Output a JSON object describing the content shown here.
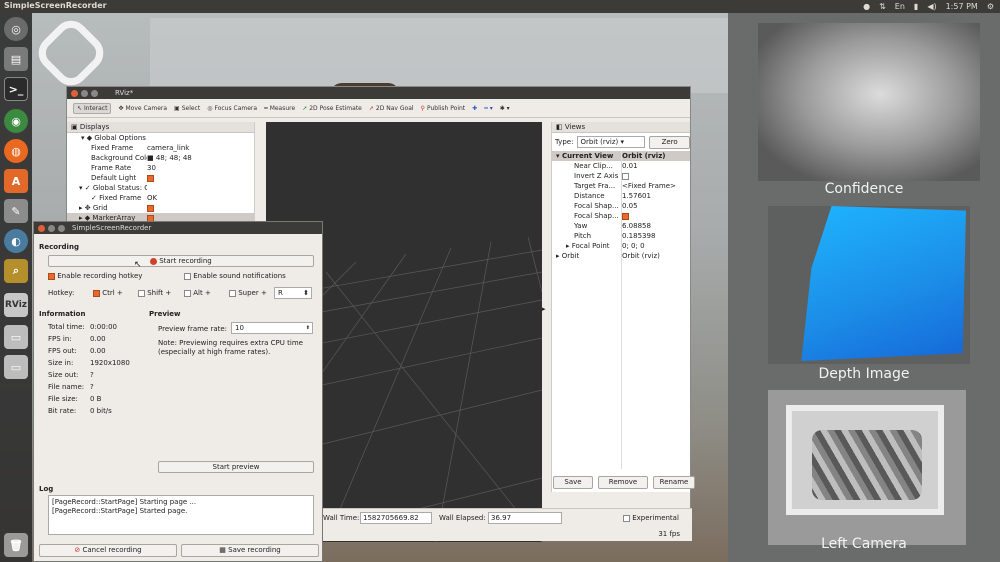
{
  "topbar": {
    "title": "SimpleScreenRecorder",
    "clock": "1:57 PM",
    "lang": "En"
  },
  "launcher": {
    "rviz_label": "RViz"
  },
  "camera_panels": {
    "confidence": "Confidence",
    "depth": "Depth Image",
    "left": "Left Camera"
  },
  "rviz": {
    "title": "RViz*",
    "toolbar": [
      "Interact",
      "Move Camera",
      "Select",
      "Focus Camera",
      "Measure",
      "2D Pose Estimate",
      "2D Nav Goal",
      "Publish Point"
    ],
    "displays_title": "Displays",
    "displays": [
      {
        "k": "Global Options",
        "v": ""
      },
      {
        "k": "Fixed Frame",
        "v": "camera_link"
      },
      {
        "k": "Background Color",
        "v": "48; 48; 48"
      },
      {
        "k": "Frame Rate",
        "v": "30"
      },
      {
        "k": "Default Light",
        "v": ""
      },
      {
        "k": "Global Status: Ok",
        "v": ""
      },
      {
        "k": "Fixed Frame",
        "v": "OK"
      },
      {
        "k": "Grid",
        "v": ""
      },
      {
        "k": "MarkerArray",
        "v": ""
      }
    ],
    "views_title": "Views",
    "type_label": "Type:",
    "type_value": "Orbit (rviz)",
    "zero": "Zero",
    "views": [
      {
        "k": "Current View",
        "v": "Orbit (rviz)"
      },
      {
        "k": "Near Clip...",
        "v": "0.01"
      },
      {
        "k": "Invert Z Axis",
        "v": ""
      },
      {
        "k": "Target Fra...",
        "v": "<Fixed Frame>"
      },
      {
        "k": "Distance",
        "v": "1.57601"
      },
      {
        "k": "Focal Shap...",
        "v": "0.05"
      },
      {
        "k": "Focal Shap...",
        "v": ""
      },
      {
        "k": "Yaw",
        "v": "6.08858"
      },
      {
        "k": "Pitch",
        "v": "0.185398"
      },
      {
        "k": "Focal Point",
        "v": "0; 0; 0"
      },
      {
        "k": "Orbit",
        "v": "Orbit (rviz)"
      }
    ],
    "save": "Save",
    "remove": "Remove",
    "rename": "Rename",
    "wall_time_label": "Wall Time:",
    "wall_time": "1582705669.82",
    "wall_elapsed_label": "Wall Elapsed:",
    "wall_elapsed": "36.97",
    "experimental": "Experimental",
    "fps": "31 fps"
  },
  "ssr": {
    "title": "SimpleScreenRecorder",
    "recording_section": "Recording",
    "start_recording": "Start recording",
    "enable_hotkey": "Enable recording hotkey",
    "enable_sound": "Enable sound notifications",
    "hotkey_label": "Hotkey:",
    "ctrl": "Ctrl +",
    "shift": "Shift +",
    "alt": "Alt +",
    "super": "Super +",
    "key": "R",
    "information": "Information",
    "info": [
      {
        "k": "Total time:",
        "v": "0:00:00"
      },
      {
        "k": "FPS in:",
        "v": "0.00"
      },
      {
        "k": "FPS out:",
        "v": "0.00"
      },
      {
        "k": "Size in:",
        "v": "1920x1080"
      },
      {
        "k": "Size out:",
        "v": "?"
      },
      {
        "k": "File name:",
        "v": "?"
      },
      {
        "k": "File size:",
        "v": "0 B"
      },
      {
        "k": "Bit rate:",
        "v": "0 bit/s"
      }
    ],
    "preview": "Preview",
    "preview_rate_label": "Preview frame rate:",
    "preview_rate": "10",
    "preview_note": "Note: Previewing requires extra CPU time (especially at high frame rates).",
    "start_preview": "Start preview",
    "log": "Log",
    "log_lines": [
      "[PageRecord::StartPage] Starting page ...",
      "[PageRecord::StartPage] Started page."
    ],
    "cancel": "Cancel recording",
    "save": "Save recording"
  }
}
